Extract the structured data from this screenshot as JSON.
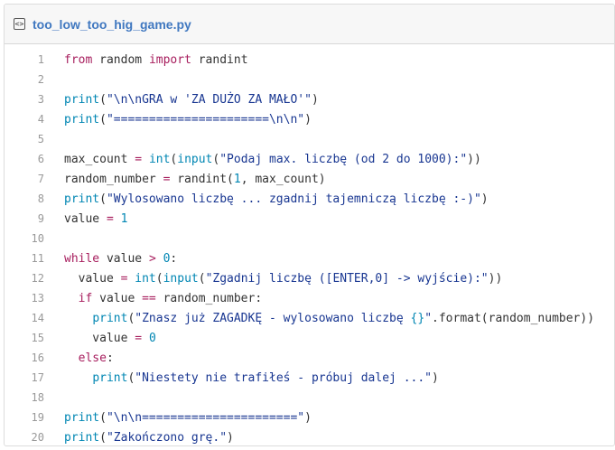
{
  "file": {
    "icon": "code-file-icon",
    "icon_glyph": "<>",
    "name": "too_low_too_hig_game.py"
  },
  "colors": {
    "keyword": "#a71d5d",
    "builtin": "#0086b3",
    "string": "#183691",
    "number": "#0086b3",
    "plain": "#333333",
    "line_number": "#999999",
    "filename_link": "#4078c0"
  },
  "lines": [
    {
      "num": "1",
      "tokens": [
        {
          "t": "k",
          "v": "from"
        },
        {
          "t": "p",
          "v": " random "
        },
        {
          "t": "k",
          "v": "import"
        },
        {
          "t": "p",
          "v": " randint"
        }
      ]
    },
    {
      "num": "2",
      "tokens": []
    },
    {
      "num": "3",
      "tokens": [
        {
          "t": "b",
          "v": "print"
        },
        {
          "t": "p",
          "v": "("
        },
        {
          "t": "s",
          "v": "\"\\n\\nGRA w 'ZA DUŻO ZA MAŁO'\""
        },
        {
          "t": "p",
          "v": ")"
        }
      ]
    },
    {
      "num": "4",
      "tokens": [
        {
          "t": "b",
          "v": "print"
        },
        {
          "t": "p",
          "v": "("
        },
        {
          "t": "s",
          "v": "\"======================\\n\\n\""
        },
        {
          "t": "p",
          "v": ")"
        }
      ]
    },
    {
      "num": "5",
      "tokens": []
    },
    {
      "num": "6",
      "tokens": [
        {
          "t": "p",
          "v": "max_count "
        },
        {
          "t": "o",
          "v": "="
        },
        {
          "t": "p",
          "v": " "
        },
        {
          "t": "b",
          "v": "int"
        },
        {
          "t": "p",
          "v": "("
        },
        {
          "t": "b",
          "v": "input"
        },
        {
          "t": "p",
          "v": "("
        },
        {
          "t": "s",
          "v": "\"Podaj max. liczbę (od 2 do 1000):\""
        },
        {
          "t": "p",
          "v": "))"
        }
      ]
    },
    {
      "num": "7",
      "tokens": [
        {
          "t": "p",
          "v": "random_number "
        },
        {
          "t": "o",
          "v": "="
        },
        {
          "t": "p",
          "v": " randint("
        },
        {
          "t": "n",
          "v": "1"
        },
        {
          "t": "p",
          "v": ", max_count)"
        }
      ]
    },
    {
      "num": "8",
      "tokens": [
        {
          "t": "b",
          "v": "print"
        },
        {
          "t": "p",
          "v": "("
        },
        {
          "t": "s",
          "v": "\"Wylosowano liczbę ... zgadnij tajemniczą liczbę :-)\""
        },
        {
          "t": "p",
          "v": ")"
        }
      ]
    },
    {
      "num": "9",
      "tokens": [
        {
          "t": "p",
          "v": "value "
        },
        {
          "t": "o",
          "v": "="
        },
        {
          "t": "p",
          "v": " "
        },
        {
          "t": "n",
          "v": "1"
        }
      ]
    },
    {
      "num": "10",
      "tokens": []
    },
    {
      "num": "11",
      "tokens": [
        {
          "t": "k",
          "v": "while"
        },
        {
          "t": "p",
          "v": " value "
        },
        {
          "t": "o",
          "v": ">"
        },
        {
          "t": "p",
          "v": " "
        },
        {
          "t": "n",
          "v": "0"
        },
        {
          "t": "p",
          "v": ":"
        }
      ]
    },
    {
      "num": "12",
      "tokens": [
        {
          "t": "p",
          "v": "  value "
        },
        {
          "t": "o",
          "v": "="
        },
        {
          "t": "p",
          "v": " "
        },
        {
          "t": "b",
          "v": "int"
        },
        {
          "t": "p",
          "v": "("
        },
        {
          "t": "b",
          "v": "input"
        },
        {
          "t": "p",
          "v": "("
        },
        {
          "t": "s",
          "v": "\"Zgadnij liczbę ([ENTER,0] -> wyjście):\""
        },
        {
          "t": "p",
          "v": "))"
        }
      ]
    },
    {
      "num": "13",
      "tokens": [
        {
          "t": "p",
          "v": "  "
        },
        {
          "t": "k",
          "v": "if"
        },
        {
          "t": "p",
          "v": " value "
        },
        {
          "t": "o",
          "v": "=="
        },
        {
          "t": "p",
          "v": " random_number:"
        }
      ]
    },
    {
      "num": "14",
      "tokens": [
        {
          "t": "p",
          "v": "    "
        },
        {
          "t": "b",
          "v": "print"
        },
        {
          "t": "p",
          "v": "("
        },
        {
          "t": "s",
          "v": "\"Znasz już ZAGADKĘ - wylosowano liczbę "
        },
        {
          "t": "b",
          "v": "{}"
        },
        {
          "t": "s",
          "v": "\""
        },
        {
          "t": "p",
          "v": ".format(random_number))"
        }
      ]
    },
    {
      "num": "15",
      "tokens": [
        {
          "t": "p",
          "v": "    value "
        },
        {
          "t": "o",
          "v": "="
        },
        {
          "t": "p",
          "v": " "
        },
        {
          "t": "n",
          "v": "0"
        }
      ]
    },
    {
      "num": "16",
      "tokens": [
        {
          "t": "p",
          "v": "  "
        },
        {
          "t": "k",
          "v": "else"
        },
        {
          "t": "p",
          "v": ":"
        }
      ]
    },
    {
      "num": "17",
      "tokens": [
        {
          "t": "p",
          "v": "    "
        },
        {
          "t": "b",
          "v": "print"
        },
        {
          "t": "p",
          "v": "("
        },
        {
          "t": "s",
          "v": "\"Niestety nie trafiłeś - próbuj dalej ...\""
        },
        {
          "t": "p",
          "v": ")"
        }
      ]
    },
    {
      "num": "18",
      "tokens": []
    },
    {
      "num": "19",
      "tokens": [
        {
          "t": "b",
          "v": "print"
        },
        {
          "t": "p",
          "v": "("
        },
        {
          "t": "s",
          "v": "\"\\n\\n======================\""
        },
        {
          "t": "p",
          "v": ")"
        }
      ]
    },
    {
      "num": "20",
      "tokens": [
        {
          "t": "b",
          "v": "print"
        },
        {
          "t": "p",
          "v": "("
        },
        {
          "t": "s",
          "v": "\"Zakończono grę.\""
        },
        {
          "t": "p",
          "v": ")"
        }
      ]
    }
  ]
}
